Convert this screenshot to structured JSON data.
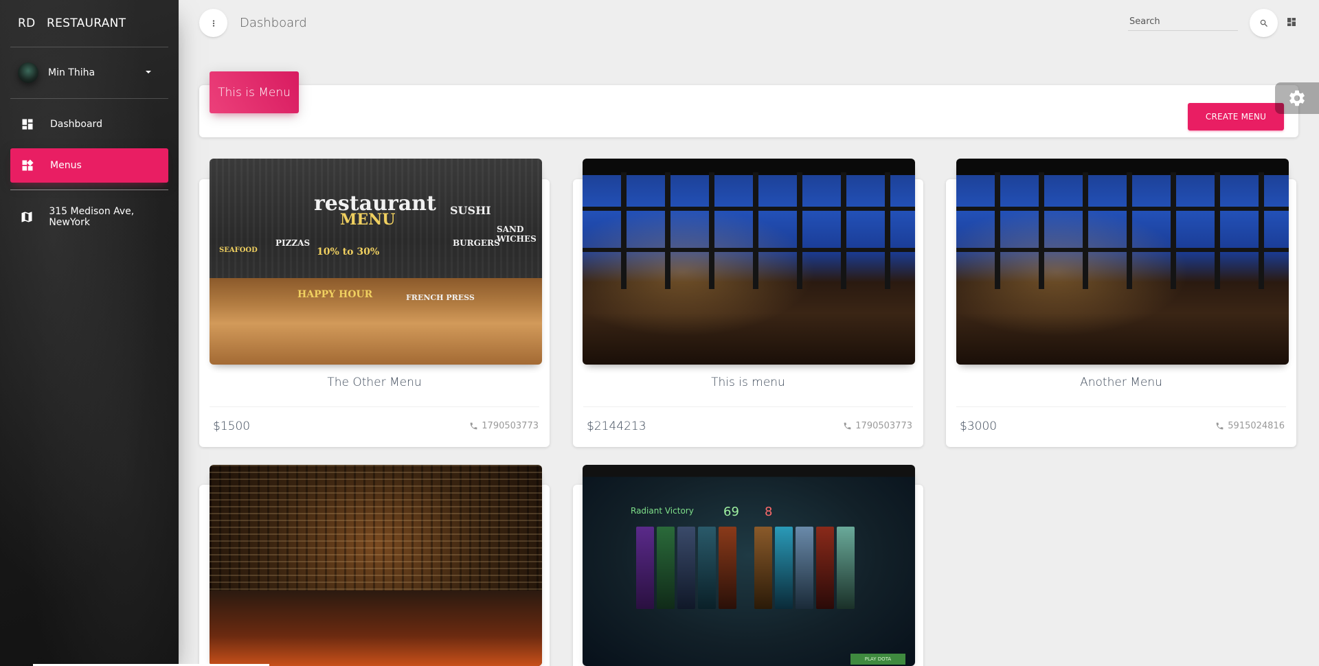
{
  "sidebar": {
    "logo_mini": "RD",
    "logo_normal": "RESTAURANT",
    "user_name": "Min Thiha",
    "items": [
      {
        "label": "Dashboard",
        "icon": "dashboard-icon",
        "active": false
      },
      {
        "label": "Menus",
        "icon": "widgets-icon",
        "active": true
      }
    ],
    "address": "315 Medison Ave, NewYork",
    "address_icon": "map-icon"
  },
  "topbar": {
    "brand": "Dashboard",
    "search_placeholder": "Search",
    "minimize_icon": "more-vert-icon",
    "search_icon": "search-icon",
    "dashboard_icon": "dashboard-icon"
  },
  "header_card": {
    "title": "This is Menu",
    "create_label": "CREATE MENU"
  },
  "menus": [
    {
      "title": "The Other Menu",
      "price": "$1500",
      "phone": "1790503773",
      "image": "restaurant chalkboard menu with bar counter"
    },
    {
      "title": "This is menu",
      "price": "$2144213",
      "phone": "1790503773",
      "image": "night city-view restaurant interior"
    },
    {
      "title": "Another Menu",
      "price": "$3000",
      "phone": "5915024816",
      "image": "night city-view restaurant interior"
    },
    {
      "title": "",
      "price": "",
      "phone": "",
      "image": "wine cellar dining room"
    },
    {
      "title": "",
      "price": "",
      "phone": "",
      "image": "game results screenshot"
    }
  ],
  "image_text": {
    "chalk_word_1": "restaurant",
    "chalk_word_2": "MENU",
    "chalk_sushi": "SUSHI",
    "chalk_pizzas": "PIZZAS",
    "chalk_burgers": "BURGERS",
    "chalk_percent": "10% to 30%",
    "chalk_happy": "HAPPY HOUR",
    "chalk_french": "FRENCH PRESS",
    "chalk_seafood": "SEAFOOD",
    "chalk_sand": "SAND WICHES",
    "game_victory": "Radiant Victory",
    "game_score_a": "69",
    "game_score_b": "8",
    "game_play": "PLAY DOTA"
  },
  "colors": {
    "accent": "#e91e63",
    "background": "#eeeeee",
    "sidebar": "#1d1d1d"
  }
}
